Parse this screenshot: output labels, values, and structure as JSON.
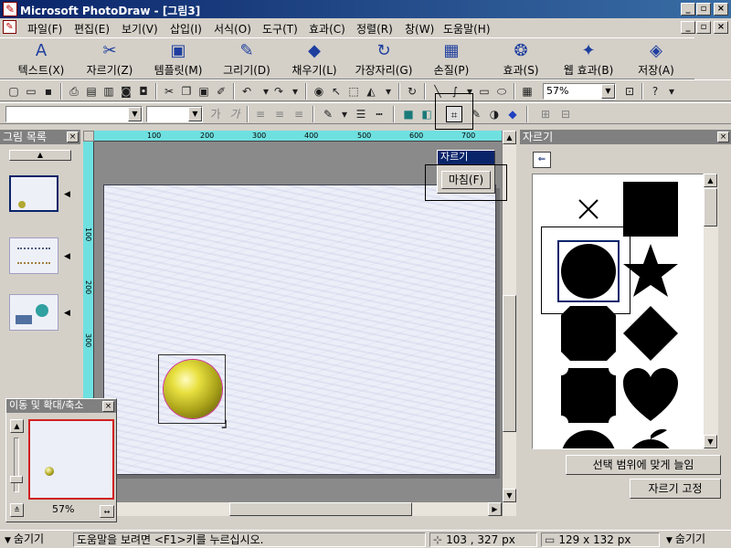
{
  "window": {
    "title": "Microsoft PhotoDraw - [그림3]",
    "minimize": "_",
    "restore": "▫",
    "close": "×"
  },
  "menu": [
    "파일(F)",
    "편집(E)",
    "보기(V)",
    "삽입(I)",
    "서식(O)",
    "도구(T)",
    "효과(C)",
    "정렬(R)",
    "창(W)",
    "도움말(H)"
  ],
  "big_toolbar": [
    "텍스트(X)",
    "자르기(Z)",
    "템플릿(M)",
    "그리기(D)",
    "채우기(L)",
    "가장자리(G)",
    "손질(P)",
    "효과(S)",
    "웹 효과(B)",
    "저장(A)"
  ],
  "toolbar": {
    "zoom": "57%",
    "format_text_bold": "가",
    "format_text_italic": "가"
  },
  "left_panel": {
    "title": "그림 목록"
  },
  "ruler": {
    "h_ticks": [
      "100",
      "200",
      "300",
      "400",
      "500",
      "600",
      "700"
    ],
    "v_ticks": [
      "100",
      "200",
      "300"
    ]
  },
  "popup": {
    "title": "자르기",
    "finish_button": "마침(F)"
  },
  "right_panel": {
    "title": "자르기",
    "fit_button": "선택 범위에 맞게 늘임",
    "lock_button": "자르기 고정"
  },
  "nav_panel": {
    "title": "이동 및 확대/축소",
    "zoom": "57%"
  },
  "statusbar": {
    "hide_left": "숨기기",
    "help_text": "도움말을 보려면 <F1>키를 누르십시오.",
    "position": "103 , 327  px",
    "size": "129 x 132  px",
    "hide_right": "숨기기"
  },
  "colors": {
    "title_start": "#0a246a",
    "title_end": "#3a6ea5",
    "ruler": "#6fe0e0",
    "nav_border": "#d02020"
  }
}
